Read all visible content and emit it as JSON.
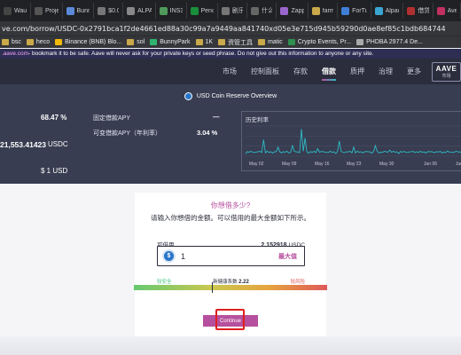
{
  "browser": {
    "tabs": [
      {
        "label": "Waul",
        "color": "#444"
      },
      {
        "label": "Proje",
        "color": "#555"
      },
      {
        "label": "Bunn",
        "color": "#5b8ad9"
      },
      {
        "label": "$0.0",
        "color": "#777"
      },
      {
        "label": "ALPA",
        "color": "#888"
      },
      {
        "label": "INS3",
        "color": "#4f9a5b"
      },
      {
        "label": "Penc",
        "color": "#1a8f3a"
      },
      {
        "label": "剧乐",
        "color": "#777"
      },
      {
        "label": "什么",
        "color": "#666"
      },
      {
        "label": "Zapp",
        "color": "#9966cc"
      },
      {
        "label": "farm",
        "color": "#caa94a"
      },
      {
        "label": "ForTu",
        "color": "#3f7fd6"
      },
      {
        "label": "Alpac",
        "color": "#3aa6d0"
      },
      {
        "label": "借贷",
        "color": "#b03030"
      },
      {
        "label": "Ave",
        "color": "#c03060"
      }
    ],
    "url": "ve.com/borrow/USDC-0x2791bca1f2de4661ed88a30c99a7a9449aa841740xd05e3e715d945b59290d0ae8ef85c1bdb684744",
    "bookmarks": [
      {
        "label": "bsc",
        "color": "#caa94a"
      },
      {
        "label": "heco",
        "color": "#caa94a"
      },
      {
        "label": "Binance (BNB) Blo...",
        "color": "#f0b90b"
      },
      {
        "label": "sol",
        "color": "#caa94a"
      },
      {
        "label": "BunnyPark",
        "color": "#2fb36f"
      },
      {
        "label": "1K",
        "color": "#caa94a"
      },
      {
        "label": "资管工具",
        "color": "#caa94a"
      },
      {
        "label": "matic",
        "color": "#caa94a"
      },
      {
        "label": "Crypto Events, Pr...",
        "color": "#2f8f4f"
      },
      {
        "label": "PHDBA 2977.4 De...",
        "color": "#aaaaaa"
      }
    ],
    "warning_site": ".aave.com",
    "warning_text": " - bookmark it to be safe. Aave will never ask for your private keys or seed phrase. Do not give out this information to anyone or any site."
  },
  "nav": {
    "links": [
      "市场",
      "控制面板",
      "存款",
      "借款",
      "质押",
      "治理",
      "更多"
    ],
    "active_index": 3,
    "logo_text": "AAVE",
    "logo_sub": "市场"
  },
  "overview": {
    "title": "USD Coin Reserve Overview",
    "utilization": "68.47 %",
    "total_liquidity": "21,553.41423",
    "total_liquidity_unit": "USDC",
    "price": "$ 1 USD",
    "stable_apy_label": "固定借款APY",
    "stable_apy_value": "—",
    "variable_apy_label": "可变借款APY（年利率）",
    "variable_apy_value": "3.04 %",
    "chart_title": "历史利率",
    "chart_dates": [
      "May 02",
      "May 09",
      "May 16",
      "May 23",
      "May 30",
      "Jun 06",
      "Jun"
    ]
  },
  "form": {
    "question": "你想借多少?",
    "subtitle": "请输入你想借的金额。可以借用的最大金额如下所示。",
    "available_label": "可借用",
    "available_value": "2.152918",
    "available_unit": "USDC",
    "amount_value": "1",
    "max_label": "最大值",
    "health_safe_label": "较安全",
    "health_factor_label": "新健康系数",
    "health_factor_value": "2.22",
    "health_risk_label": "较风险",
    "continue_label": "Continue"
  }
}
